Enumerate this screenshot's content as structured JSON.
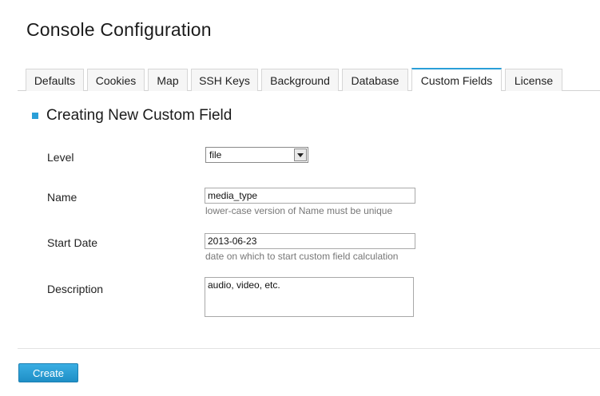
{
  "page": {
    "title": "Console Configuration"
  },
  "tabs": [
    {
      "label": "Defaults",
      "active": false
    },
    {
      "label": "Cookies",
      "active": false
    },
    {
      "label": "Map",
      "active": false
    },
    {
      "label": "SSH Keys",
      "active": false
    },
    {
      "label": "Background",
      "active": false
    },
    {
      "label": "Database",
      "active": false
    },
    {
      "label": "Custom Fields",
      "active": true
    },
    {
      "label": "License",
      "active": false
    }
  ],
  "section": {
    "title": "Creating New Custom Field"
  },
  "form": {
    "level": {
      "label": "Level",
      "value": "file"
    },
    "name": {
      "label": "Name",
      "value": "media_type",
      "hint": "lower-case version of Name must be unique"
    },
    "start_date": {
      "label": "Start Date",
      "value": "2013-06-23",
      "hint": "date on which to start custom field calculation"
    },
    "description": {
      "label": "Description",
      "value": "audio, video, etc."
    }
  },
  "actions": {
    "create_label": "Create"
  },
  "colors": {
    "accent": "#2a9fd8"
  }
}
